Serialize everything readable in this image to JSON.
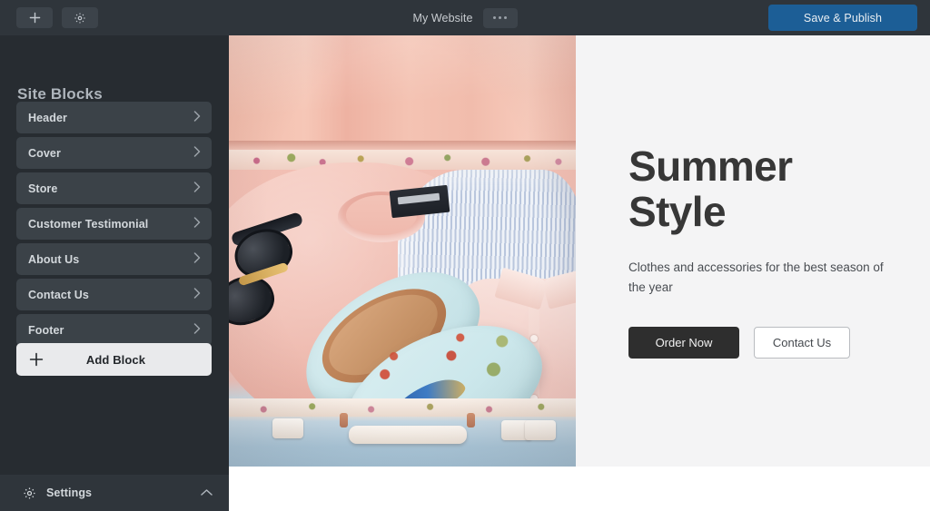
{
  "topbar": {
    "add_icon": "plus-icon",
    "settings_icon": "gear-icon",
    "site_title": "My Website",
    "more_icon": "ellipsis-icon",
    "publish_label": "Save & Publish",
    "publish_color": "#1c5e96"
  },
  "sidebar": {
    "title": "Site Blocks",
    "blocks": [
      {
        "label": "Header",
        "chevron": "chevron-right-icon"
      },
      {
        "label": "Cover",
        "chevron": "chevron-right-icon"
      },
      {
        "label": "Store",
        "chevron": "chevron-right-icon"
      },
      {
        "label": "Customer Testimonial",
        "chevron": "chevron-right-icon"
      },
      {
        "label": "About Us",
        "chevron": "chevron-right-icon"
      },
      {
        "label": "Contact Us",
        "chevron": "chevron-right-icon"
      },
      {
        "label": "Footer",
        "chevron": "chevron-right-icon"
      }
    ],
    "add_block": {
      "label": "Add Block",
      "icon": "plus-icon"
    },
    "settings": {
      "label": "Settings",
      "icon": "gear-icon",
      "chevron": "chevron-up-icon"
    }
  },
  "canvas": {
    "hero": {
      "image_alt": "flat-lay of pink suitcase with t-shirt, striped shirt, sunglasses and floral loafers",
      "heading": "Summer Style",
      "subtitle": "Clothes and accessories for the best season of the year",
      "primary_button": "Order Now",
      "secondary_button": "Contact Us",
      "primary_color": "#2e2e2e",
      "background_color": "#f4f4f5"
    }
  }
}
